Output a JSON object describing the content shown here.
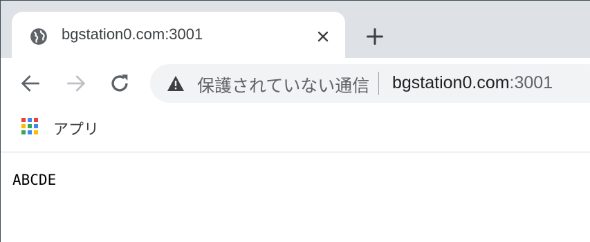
{
  "tab": {
    "title": "bgstation0.com:3001",
    "favicon": "globe-icon",
    "close_icon": "close-icon"
  },
  "new_tab_icon": "plus-icon",
  "toolbar": {
    "back_icon": "arrow-left-icon",
    "forward_icon": "arrow-right-icon",
    "reload_icon": "reload-icon"
  },
  "omnibox": {
    "security_icon": "warning-triangle-icon",
    "security_text": "保護されていない通信",
    "url_host": "bgstation0.com",
    "url_port": ":3001"
  },
  "bookmarks": {
    "apps_label": "アプリ",
    "apps_colors": [
      "#ea4335",
      "#4285f4",
      "#ea4335",
      "#fbbc05",
      "#34a853",
      "#4285f4",
      "#34a853",
      "#4285f4",
      "#fbbc05"
    ]
  },
  "page": {
    "text": "ABCDE"
  },
  "colors": {
    "tabstrip": "#dee1e6",
    "omnibox": "#f1f3f4",
    "icon": "#5f6368",
    "icon_disabled": "#bdc1c6"
  }
}
